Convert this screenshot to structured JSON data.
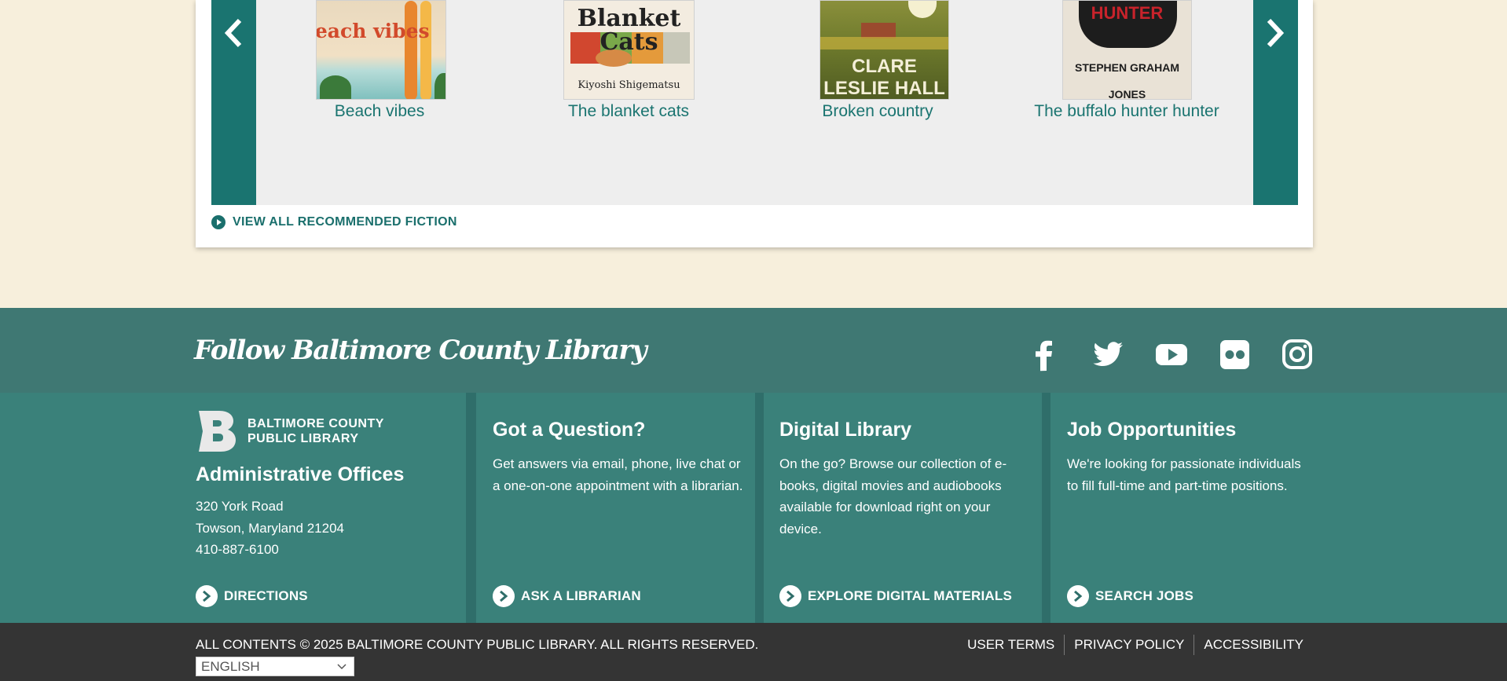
{
  "carousel": {
    "books": [
      {
        "title": "Beach vibes",
        "cover_text": "beach vibes"
      },
      {
        "title": "The blanket cats",
        "cover_text": "Blanket Cats",
        "cover_author": "Kiyoshi Shigematsu"
      },
      {
        "title": "Broken country",
        "cover_text": "CLARE LESLIE HALL"
      },
      {
        "title": "The buffalo hunter hunter",
        "cover_text": "STEPHEN GRAHAM JONES",
        "cover_title": "HUNTER"
      }
    ],
    "view_all_label": "VIEW ALL RECOMMENDED FICTION"
  },
  "follow": {
    "title": "Follow Baltimore County Library",
    "social": [
      "facebook-icon",
      "twitter-icon",
      "youtube-icon",
      "flickr-icon",
      "instagram-icon"
    ]
  },
  "footer": {
    "logo_line1": "BALTIMORE COUNTY",
    "logo_line2": "PUBLIC LIBRARY",
    "admin": {
      "heading": "Administrative Offices",
      "address1": "320 York Road",
      "address2": "Towson, Maryland 21204",
      "phone": "410-887-6100",
      "cta": "DIRECTIONS"
    },
    "question": {
      "heading": "Got a Question?",
      "text": "Get answers via email, phone, live chat or a one-on-one appointment with a librarian.",
      "cta": "ASK A LIBRARIAN"
    },
    "digital": {
      "heading": "Digital Library",
      "text": "On the go? Browse our collection of e-books, digital movies and audiobooks available for download right on your device.",
      "cta": "EXPLORE DIGITAL MATERIALS"
    },
    "jobs": {
      "heading": "Job Opportunities",
      "text": "We're looking for passionate individuals to fill full-time and part-time positions.",
      "cta": "SEARCH JOBS"
    }
  },
  "bottom": {
    "copyright": "ALL CONTENTS © 2025 BALTIMORE COUNTY PUBLIC LIBRARY. ALL RIGHTS RESERVED.",
    "links": [
      "USER TERMS",
      "PRIVACY POLICY",
      "ACCESSIBILITY"
    ],
    "language": "ENGLISH"
  },
  "colors": {
    "teal": "#1a7470",
    "cream": "#f7efdc",
    "footer": "#3a817a",
    "bottom": "#343434"
  }
}
